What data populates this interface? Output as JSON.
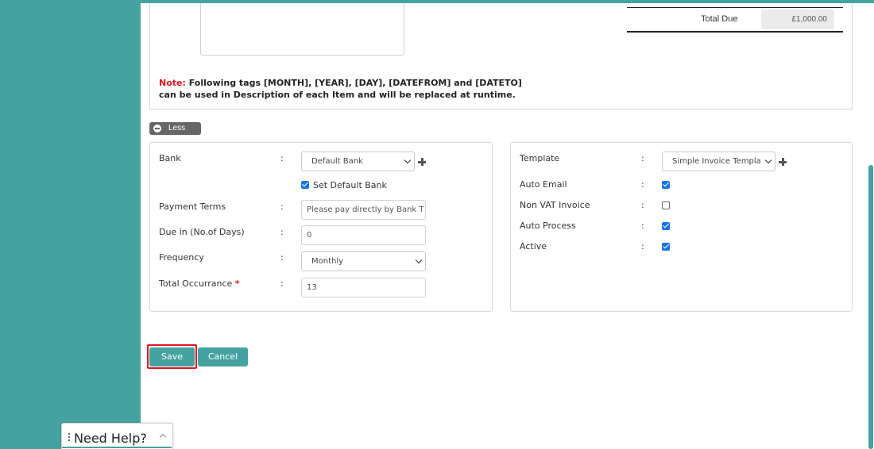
{
  "invoice": {
    "note_label": "Note:",
    "note_text": " Following tags [MONTH], [YEAR], [DAY], [DATEFROM] and [DATETO] can be used in Description of each Item and will be replaced at runtime.",
    "total_due_label": "Total Due",
    "total_due_value": "£1,000.00"
  },
  "toggle": {
    "label": "Less"
  },
  "left_panel": {
    "bank_label": "Bank",
    "bank_selected": "Default Bank",
    "set_default_bank_label": "Set Default Bank",
    "set_default_bank_checked": true,
    "payment_terms_label": "Payment Terms",
    "payment_terms_value": "Please pay directly by Bank T",
    "due_days_label": "Due in (No.of Days)",
    "due_days_value": "0",
    "frequency_label": "Frequency",
    "frequency_selected": "Monthly",
    "total_occurrance_label": "Total Occurrance",
    "required_marker": "*",
    "total_occurrance_value": "13",
    "colon": ":"
  },
  "right_panel": {
    "template_label": "Template",
    "template_selected": "Simple Invoice Templa",
    "auto_email_label": "Auto Email",
    "auto_email_checked": true,
    "non_vat_label": "Non VAT Invoice",
    "non_vat_checked": false,
    "auto_process_label": "Auto Process",
    "auto_process_checked": true,
    "active_label": "Active",
    "active_checked": true,
    "colon": ":"
  },
  "actions": {
    "save_label": "Save",
    "cancel_label": "Cancel"
  },
  "help": {
    "label": "Need Help?"
  },
  "colors": {
    "accent": "#44a3a0",
    "highlight": "#e0141e",
    "checkbox": "#1a73e8"
  }
}
